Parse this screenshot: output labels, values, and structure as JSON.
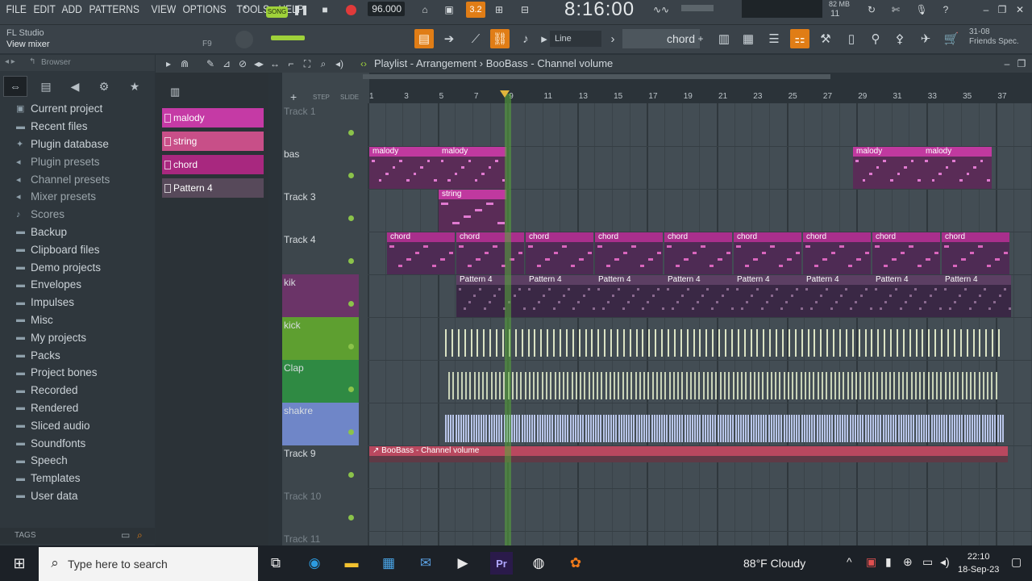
{
  "menu": [
    "FILE",
    "EDIT",
    "ADD",
    "PATTERNS",
    "VIEW",
    "OPTIONS",
    "TOOLS",
    "HELP"
  ],
  "transport": {
    "mode": "SONG",
    "tempo": "96.000",
    "time": "8:16:00",
    "pattern_num": "3.2"
  },
  "memory": {
    "ram": "82 MB",
    "cpu": "11"
  },
  "hint": {
    "app": "FL Studio",
    "text": "View mixer",
    "key": "F9"
  },
  "toolbar": {
    "snap": "Line",
    "pattern_selector": "chord"
  },
  "news": {
    "date": "31-08",
    "title": "Friends Spec."
  },
  "browser": {
    "title": "Browser",
    "items": [
      {
        "label": "Current project",
        "icon": "project-icon"
      },
      {
        "label": "Recent files",
        "icon": "folder-icon"
      },
      {
        "label": "Plugin database",
        "icon": "plugin-icon"
      },
      {
        "label": "Plugin presets",
        "icon": "preset-icon"
      },
      {
        "label": "Channel presets",
        "icon": "preset-icon"
      },
      {
        "label": "Mixer presets",
        "icon": "preset-icon"
      },
      {
        "label": "Scores",
        "icon": "note-icon"
      },
      {
        "label": "Backup",
        "icon": "folder-icon"
      },
      {
        "label": "Clipboard files",
        "icon": "folder-icon"
      },
      {
        "label": "Demo projects",
        "icon": "folder-icon"
      },
      {
        "label": "Envelopes",
        "icon": "folder-icon"
      },
      {
        "label": "Impulses",
        "icon": "folder-icon"
      },
      {
        "label": "Misc",
        "icon": "folder-icon"
      },
      {
        "label": "My projects",
        "icon": "folder-icon"
      },
      {
        "label": "Packs",
        "icon": "folder-icon"
      },
      {
        "label": "Project bones",
        "icon": "folder-icon"
      },
      {
        "label": "Recorded",
        "icon": "folder-icon"
      },
      {
        "label": "Rendered",
        "icon": "folder-icon"
      },
      {
        "label": "Sliced audio",
        "icon": "folder-icon"
      },
      {
        "label": "Soundfonts",
        "icon": "folder-icon"
      },
      {
        "label": "Speech",
        "icon": "folder-icon"
      },
      {
        "label": "Templates",
        "icon": "folder-icon"
      },
      {
        "label": "User data",
        "icon": "folder-icon"
      }
    ],
    "tags_label": "TAGS"
  },
  "playlist": {
    "title": "Playlist - Arrangement",
    "subtitle": "BooBass - Channel volume",
    "ruler_marks": [
      "1",
      "3",
      "5",
      "7",
      "9",
      "11",
      "13",
      "15",
      "17",
      "19",
      "21",
      "23",
      "25",
      "27",
      "29",
      "31",
      "33",
      "35",
      "37"
    ],
    "patterns": [
      {
        "label": "malody",
        "color": "#c53aa5"
      },
      {
        "label": "string",
        "color": "#c84f88"
      },
      {
        "label": "chord",
        "color": "#a8287f"
      },
      {
        "label": "Pattern 4",
        "color": "#57495a"
      }
    ],
    "tracks": [
      {
        "label": "Track 1",
        "color": "#3d464c",
        "dim": true
      },
      {
        "label": "bas",
        "color": "#3d464c",
        "dim": false
      },
      {
        "label": "Track 3",
        "color": "#3d464c",
        "dim": false
      },
      {
        "label": "Track 4",
        "color": "#3d464c",
        "dim": false
      },
      {
        "label": "kik",
        "color": "#6b3468",
        "dim": false
      },
      {
        "label": "kick",
        "color": "#5e9f30",
        "dim": false
      },
      {
        "label": "Clap",
        "color": "#2f8a43",
        "dim": false
      },
      {
        "label": "shakre",
        "color": "#6f86c8",
        "dim": false
      },
      {
        "label": "Track 9",
        "color": "#3d464c",
        "dim": false
      },
      {
        "label": "Track 10",
        "color": "#3d464c",
        "dim": true
      },
      {
        "label": "Track 11",
        "color": "#3d464c",
        "dim": true
      }
    ],
    "clip_labels": {
      "malody": "malody",
      "string": "string",
      "chord": "chord",
      "pattern4": "Pattern 4",
      "automation": "BooBass - Channel volume"
    }
  },
  "taskbar": {
    "search_placeholder": "Type here to search",
    "weather": "88°F  Cloudy",
    "time": "22:10",
    "date": "18-Sep-23"
  }
}
